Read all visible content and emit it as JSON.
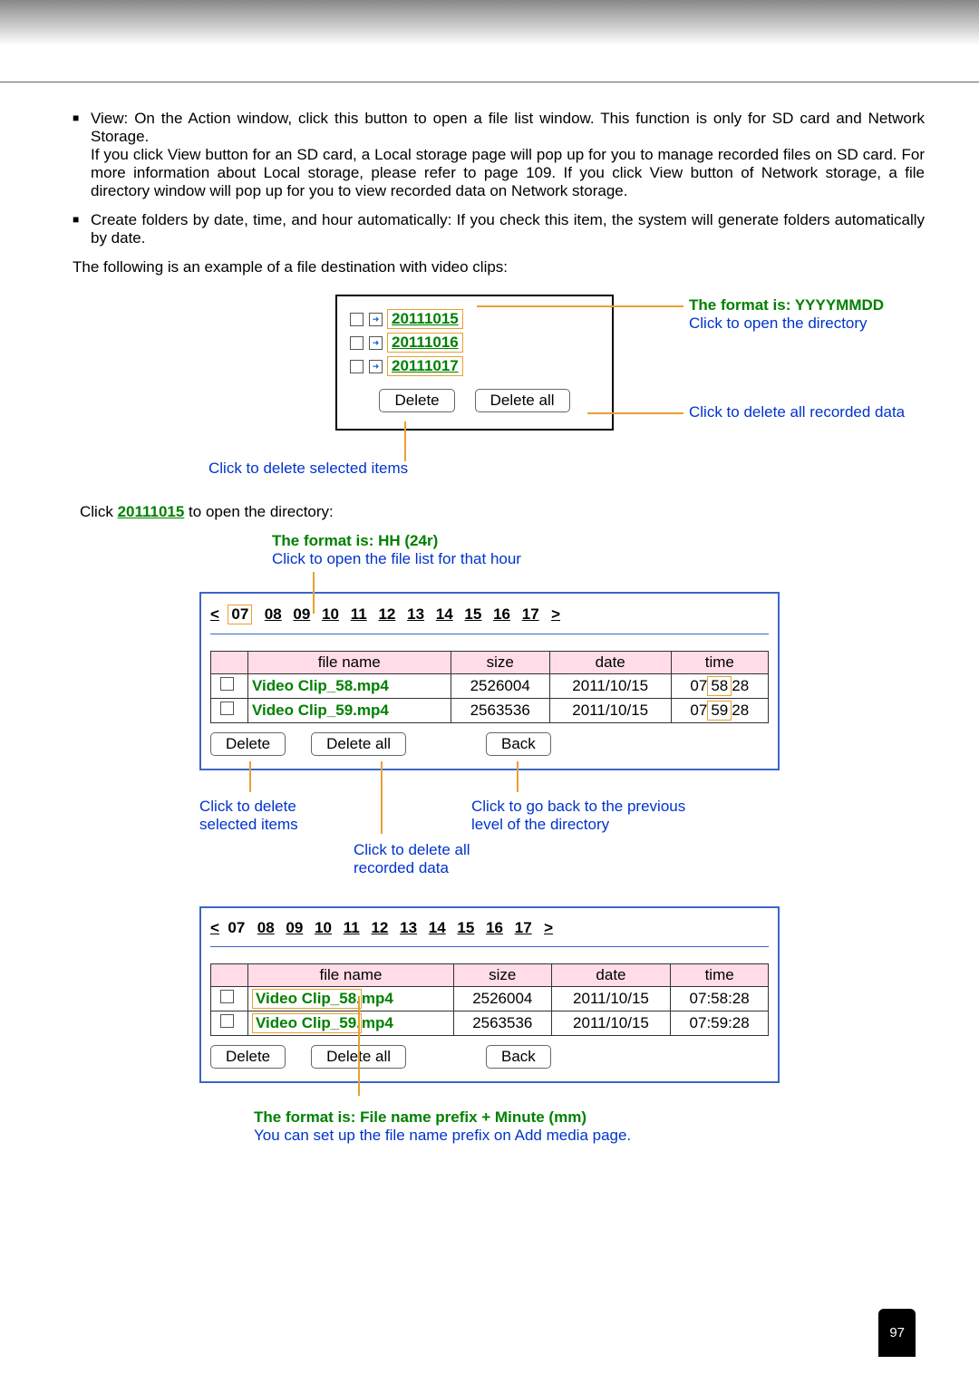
{
  "bullets": {
    "view": "View: On the Action window, click this button to open a file list window. This function is only for SD card and Network Storage.",
    "view_detail": "If you click View button for an SD card, a Local storage page will pop up for you to manage recorded files on SD card. For more information about Local storage, please refer to page 109. If you click View button of Network storage, a file directory window will pop up for you to view recorded data on Network storage.",
    "create": "Create folders by date, time, and hour automatically: If you check this item, the system will generate folders automatically by date."
  },
  "intro": "The following is an example of a file destination with video clips:",
  "d1": {
    "folders": [
      "20111015",
      "20111016",
      "20111017"
    ],
    "delete": "Delete",
    "delete_all": "Delete all",
    "ann_format": "The format is: YYYYMMDD",
    "ann_open": "Click to open the directory",
    "ann_delall": "Click to delete all recorded data",
    "ann_delsel": "Click to delete selected items"
  },
  "clickopen_pre": "Click ",
  "clickopen_link": "20111015",
  "clickopen_post": " to open the directory:",
  "d2": {
    "top_green": "The format is: HH (24r)",
    "top_blue": "Click to open the file list for that hour",
    "nav_prev": "<",
    "nav_next": ">",
    "hours": [
      "07",
      "08",
      "09",
      "10",
      "11",
      "12",
      "13",
      "14",
      "15",
      "16",
      "17"
    ],
    "headers": [
      "file name",
      "size",
      "date",
      "time"
    ],
    "rows": [
      {
        "fn": "Video Clip_58.mp4",
        "size": "2526004",
        "date": "2011/10/15",
        "time_parts": [
          "07",
          "58",
          "28"
        ]
      },
      {
        "fn": "Video Clip_59.mp4",
        "size": "2563536",
        "date": "2011/10/15",
        "time_parts": [
          "07",
          "59",
          "28"
        ]
      }
    ],
    "delete": "Delete",
    "delete_all": "Delete all",
    "back": "Back",
    "ann_delsel": "Click to delete\nselected items",
    "ann_delall": "Click to delete all\nrecorded data",
    "ann_back": "Click to go back to the previous\nlevel of the directory"
  },
  "d3": {
    "hours": [
      "07",
      "08",
      "09",
      "10",
      "11",
      "12",
      "13",
      "14",
      "15",
      "16",
      "17"
    ],
    "headers": [
      "file name",
      "size",
      "date",
      "time"
    ],
    "rows": [
      {
        "fn_parts": [
          "Video Clip_58.",
          "mp4"
        ],
        "size": "2526004",
        "date": "2011/10/15",
        "time": "07:58:28"
      },
      {
        "fn_parts": [
          "Video Clip_59.",
          "mp4"
        ],
        "size": "2563536",
        "date": "2011/10/15",
        "time": "07:59:28"
      }
    ],
    "delete": "Delete",
    "delete_all": "Delete all",
    "back": "Back",
    "ann_green": "The format is: File name prefix + Minute (mm)",
    "ann_blue": "You can set up the file name prefix on Add media page."
  },
  "page_num": "97"
}
